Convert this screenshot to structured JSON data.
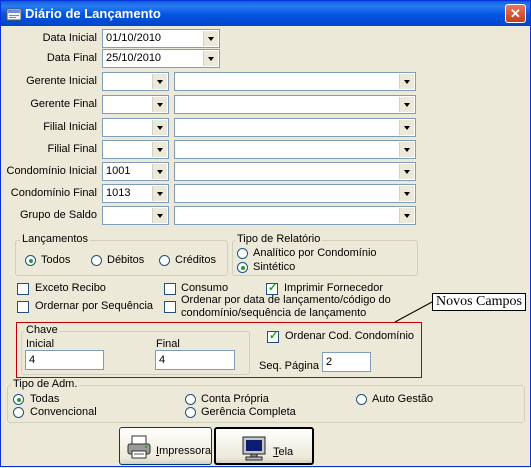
{
  "window": {
    "title": "Diário de Lançamento",
    "close_label": "✕"
  },
  "fields": {
    "data_inicial": {
      "label": "Data Inicial",
      "value": "01/10/2010"
    },
    "data_final": {
      "label": "Data Final",
      "value": "25/10/2010"
    },
    "gerente_inicial": {
      "label": "Gerente Inicial",
      "value": "",
      "desc": ""
    },
    "gerente_final": {
      "label": "Gerente Final",
      "value": "",
      "desc": ""
    },
    "filial_inicial": {
      "label": "Filial Inicial",
      "value": "",
      "desc": ""
    },
    "filial_final": {
      "label": "Filial Final",
      "value": "",
      "desc": ""
    },
    "condominio_inicial": {
      "label": "Condomínio Inicial",
      "value": "1001",
      "desc": ""
    },
    "condominio_final": {
      "label": "Condomínio Final",
      "value": "1013",
      "desc": ""
    },
    "grupo_saldo": {
      "label": "Grupo de Saldo",
      "value": "",
      "desc": ""
    }
  },
  "lancamentos": {
    "title": "Lançamentos",
    "options": [
      "Todos",
      "Débitos",
      "Créditos"
    ],
    "selected": "Todos"
  },
  "tipo_relatorio": {
    "title": "Tipo de Relatório",
    "options": [
      "Analítico por Condomínio",
      "Sintético"
    ],
    "selected": "Sintético"
  },
  "checks": {
    "exceto_recibo": {
      "label": "Exceto Recibo",
      "checked": false
    },
    "consumo": {
      "label": "Consumo",
      "checked": false
    },
    "imprimir_fornecedor": {
      "label": "Imprimir Fornecedor",
      "checked": true
    },
    "ordenar_sequencia": {
      "label": "Ordernar por Sequência",
      "checked": false
    },
    "ordenar_data": {
      "label_line1": "Ordenar por data de lançamento/código do",
      "label_line2": "condomínio/sequência de lançamento",
      "checked": false
    }
  },
  "chave": {
    "title": "Chave",
    "inicial_label": "Inicial",
    "inicial_value": "4",
    "final_label": "Final",
    "final_value": "4"
  },
  "ordenar_cod_condominio": {
    "label": "Ordenar Cod. Condomínio",
    "checked": true
  },
  "seq_pagina": {
    "label": "Seq. Página",
    "value": "2"
  },
  "callout": {
    "text": "Novos Campos"
  },
  "tipo_adm": {
    "title": "Tipo de Adm.",
    "options": [
      "Todas",
      "Conta Própria",
      "Auto Gestão",
      "Convencional",
      "Gerência Completa"
    ],
    "selected": "Todas"
  },
  "buttons": {
    "impressora": {
      "label_first": "I",
      "label_rest": "mpressora"
    },
    "tela": {
      "label_first": "T",
      "label_rest": "ela"
    }
  },
  "colors": {
    "titlebar": "#0153e1",
    "callout_border": "#c00000",
    "check_green": "#21a121"
  }
}
